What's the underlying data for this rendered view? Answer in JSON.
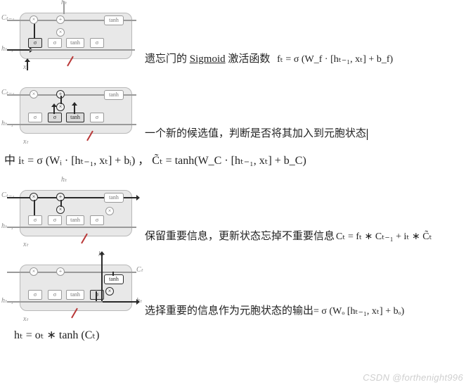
{
  "labels": {
    "h_t": "hₜ",
    "h_t1": "hₜ₋₁",
    "C_t": "Cₜ",
    "C_t1": "Cₜ₋₁",
    "x_t": "xₜ",
    "f_t": "fₜ",
    "i_t": "iₜ",
    "sigma": "σ",
    "tanh": "tanh",
    "mul": "×",
    "add": "+"
  },
  "row1": {
    "caption_pre": "遗忘门的 ",
    "caption_mid": "Sigmoid",
    "caption_post": " 激活函数",
    "formula_html": "fₜ = σ (W_f · [hₜ₋₁, xₜ]  +  b_f)"
  },
  "row2": {
    "caption": "一个新的候选值，判断是否将其加入到元胞状态",
    "big_formula_html": "中 iₜ = σ (Wᵢ · [hₜ₋₁, xₜ]  +  bᵢ)   ，  C̃ₜ = tanh(W_C · [hₜ₋₁, xₜ]  +  b_C)"
  },
  "row3": {
    "caption": "保留重要信息，更新状态忘掉不重要信息",
    "formula_html": "Cₜ = fₜ ∗ Cₜ₋₁ + iₜ ∗ C̃ₜ"
  },
  "row4": {
    "caption": "选择重要的信息作为元胞状态的输出",
    "formula_html": "= σ (Wₒ  [hₜ₋₁, xₜ]  +  bₒ)",
    "big_formula_html": "hₜ = oₜ ∗ tanh (Cₜ)"
  },
  "watermark": "CSDN @forthenight996"
}
